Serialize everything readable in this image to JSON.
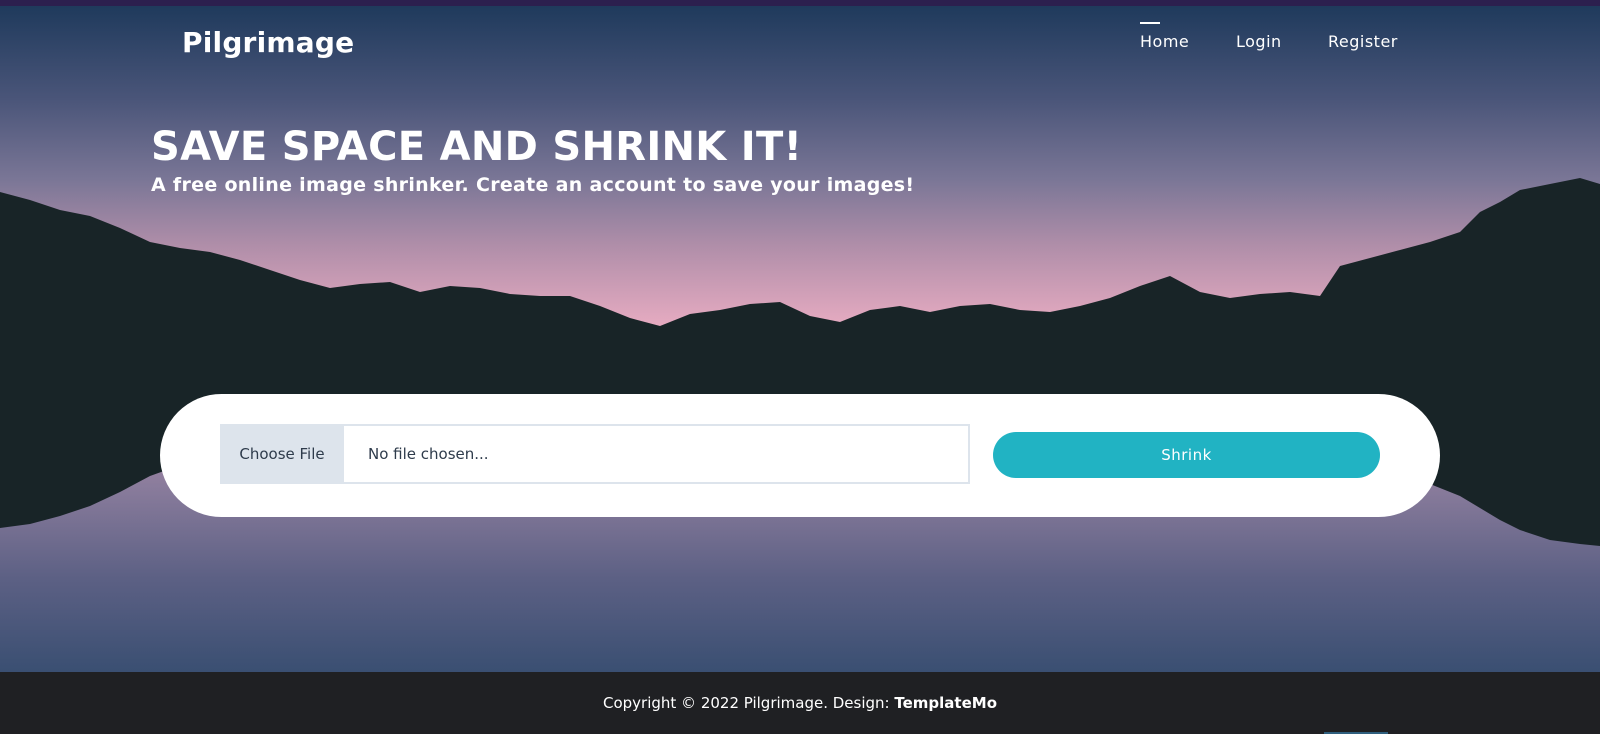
{
  "brand": {
    "name": "Pilgrimage"
  },
  "nav": {
    "active": "Home",
    "items": [
      {
        "label": "Home"
      },
      {
        "label": "Login"
      },
      {
        "label": "Register"
      }
    ]
  },
  "hero": {
    "headline": "SAVE SPACE AND SHRINK IT!",
    "subline": "A free online image shrinker. Create an account to save your images!"
  },
  "upload": {
    "choose_label": "Choose File",
    "file_status": "No file chosen...",
    "submit_label": "Shrink"
  },
  "footer": {
    "copyright": "Copyright © 2022 Pilgrimage. Design: ",
    "link_label": "TemplateMo"
  },
  "colors": {
    "accent": "#21b3c3",
    "mountain": "#182427",
    "footer_bg": "#1f2023",
    "sky_pink": "#e6abc1",
    "sky_blue": "#1f3a5c"
  }
}
